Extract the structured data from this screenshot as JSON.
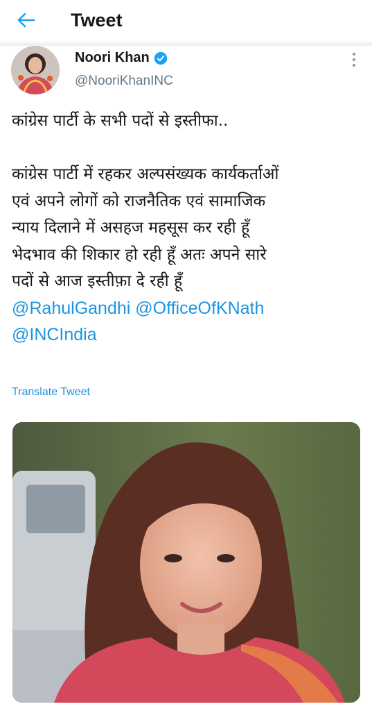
{
  "header": {
    "back_icon": "arrow-left-icon",
    "title": "Tweet"
  },
  "tweet": {
    "author_name": "Noori Khan",
    "verified_icon": "verified-badge-icon",
    "handle": "@NooriKhanINC",
    "more_icon": "more-vertical-icon",
    "text_line1": "कांग्रेस पार्टी के सभी पदों से इस्तीफा..",
    "body_lines": [
      "कांग्रेस पार्टी में रहकर अल्पसंख्यक कार्यकर्ताओं",
      "एवं अपने लोगों को राजनैतिक एवं सामाजिक",
      "न्याय दिलाने में असहज महसूस कर रही हूँ",
      "भेदभाव की शिकार हो रही हूँ अतः अपने सारे",
      "पदों से आज इस्तीफ़ा दे रही हूँ"
    ],
    "mentions": [
      "@RahulGandhi",
      "@OfficeOfKNath",
      "@INCIndia"
    ],
    "translate_label": "Translate Tweet"
  },
  "colors": {
    "accent": "#1b95e0",
    "secondary_text": "#657786",
    "primary_text": "#14171a",
    "verified": "#1da1f2"
  }
}
